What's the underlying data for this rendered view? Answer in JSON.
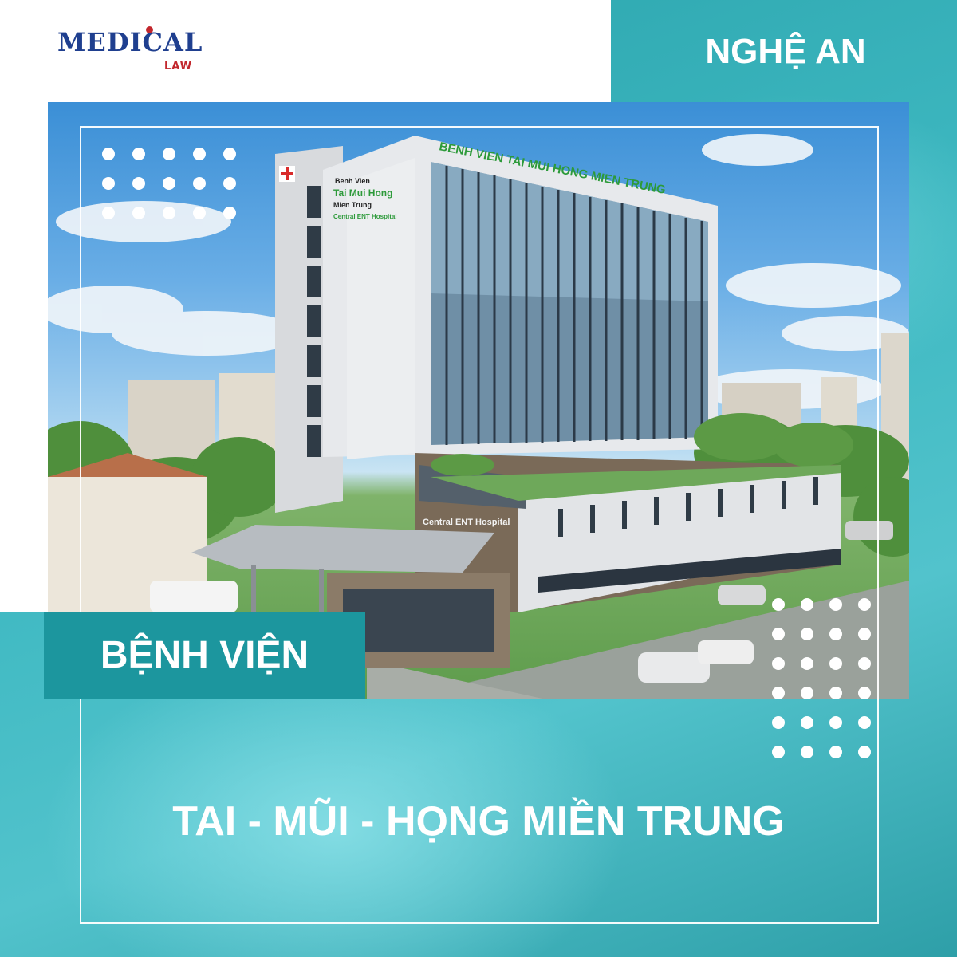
{
  "logo": {
    "main": "MEDICAL",
    "sub": "LAW"
  },
  "region": "NGHỆ AN",
  "label": "BỆNH VIỆN",
  "title": "TAI - MŨI - HỌNG MIỀN TRUNG",
  "building_signs": {
    "roof_sign": "BENH VIEN TAI MUI HONG MIEN TRUNG",
    "side_line1": "Benh Vien",
    "side_line2": "Tai Mui Hong",
    "side_line3": "Mien Trung",
    "side_line4": "Central ENT Hospital",
    "podium_sign": "Central ENT Hospital"
  },
  "colors": {
    "brand_blue": "#1f3f8f",
    "brand_red": "#c2272d",
    "teal": "#2aa3ab",
    "label_teal": "#1c969e"
  }
}
